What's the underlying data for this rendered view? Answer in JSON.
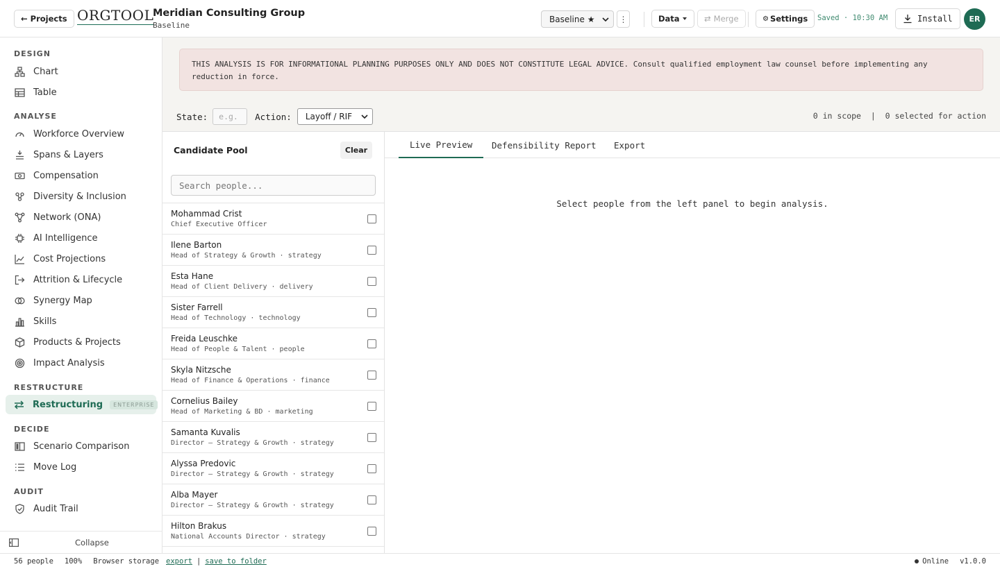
{
  "header": {
    "back_label": "← Projects",
    "logo": "ORGTOOL",
    "org_name": "Meridian Consulting Group",
    "scenario_name": "Baseline",
    "scenario_select": "Baseline ★",
    "data_label": "Data",
    "merge_label": "Merge",
    "settings_label": "Settings",
    "saved_status": "Saved · 10:30 AM",
    "install_label": "Install",
    "avatar_initials": "ER"
  },
  "sidebar": {
    "sections": [
      {
        "title": "DESIGN",
        "items": [
          {
            "label": "Chart",
            "icon": "org-chart-icon"
          },
          {
            "label": "Table",
            "icon": "table-icon"
          }
        ]
      },
      {
        "title": "ANALYSE",
        "items": [
          {
            "label": "Workforce Overview",
            "icon": "gauge-icon"
          },
          {
            "label": "Spans & Layers",
            "icon": "layers-icon"
          },
          {
            "label": "Compensation",
            "icon": "money-icon"
          },
          {
            "label": "Diversity & Inclusion",
            "icon": "people-icon"
          },
          {
            "label": "Network (ONA)",
            "icon": "network-icon"
          },
          {
            "label": "AI Intelligence",
            "icon": "chip-icon"
          },
          {
            "label": "Cost Projections",
            "icon": "line-chart-icon"
          },
          {
            "label": "Attrition & Lifecycle",
            "icon": "exit-icon"
          },
          {
            "label": "Synergy Map",
            "icon": "overlap-icon"
          },
          {
            "label": "Skills",
            "icon": "bar-chart-icon"
          },
          {
            "label": "Products & Projects",
            "icon": "box-icon"
          },
          {
            "label": "Impact Analysis",
            "icon": "target-icon"
          }
        ]
      },
      {
        "title": "RESTRUCTURE",
        "items": [
          {
            "label": "Restructuring",
            "icon": "swap-icon",
            "badge": "ENTERPRISE",
            "active": true
          }
        ]
      },
      {
        "title": "DECIDE",
        "items": [
          {
            "label": "Scenario Comparison",
            "icon": "columns-icon"
          },
          {
            "label": "Move Log",
            "icon": "list-icon"
          }
        ]
      },
      {
        "title": "AUDIT",
        "items": [
          {
            "label": "Audit Trail",
            "icon": "shield-check-icon"
          }
        ]
      }
    ],
    "collapse_label": "Collapse"
  },
  "disclaimer": "THIS ANALYSIS IS FOR INFORMATIONAL PLANNING PURPOSES ONLY AND DOES NOT CONSTITUTE LEGAL ADVICE. Consult qualified employment law counsel before implementing any reduction in force.",
  "filters": {
    "state_label": "State:",
    "state_placeholder": "e.g.",
    "action_label": "Action:",
    "action_value": "Layoff / RIF",
    "scope_text": "0 in scope  |  0 selected for action"
  },
  "candidate_pool": {
    "title": "Candidate Pool",
    "clear_label": "Clear",
    "search_placeholder": "Search people...",
    "people": [
      {
        "name": "Mohammad Crist",
        "role": "Chief Executive Officer"
      },
      {
        "name": "Ilene Barton",
        "role": "Head of Strategy & Growth · strategy"
      },
      {
        "name": "Esta Hane",
        "role": "Head of Client Delivery · delivery"
      },
      {
        "name": "Sister Farrell",
        "role": "Head of Technology · technology"
      },
      {
        "name": "Freida Leuschke",
        "role": "Head of People & Talent · people"
      },
      {
        "name": "Skyla Nitzsche",
        "role": "Head of Finance & Operations · finance"
      },
      {
        "name": "Cornelius Bailey",
        "role": "Head of Marketing & BD · marketing"
      },
      {
        "name": "Samanta Kuvalis",
        "role": "Director — Strategy & Growth · strategy"
      },
      {
        "name": "Alyssa Predovic",
        "role": "Director — Strategy & Growth · strategy"
      },
      {
        "name": "Alba Mayer",
        "role": "Director — Strategy & Growth · strategy"
      },
      {
        "name": "Hilton Brakus",
        "role": "National Accounts Director · strategy"
      }
    ]
  },
  "tabs": [
    "Live Preview",
    "Defensibility Report",
    "Export"
  ],
  "empty_message": "Select people from the left panel to begin analysis.",
  "statusbar": {
    "people_count": "56 people",
    "zoom": "100%",
    "storage": "Browser storage",
    "export_link": "export",
    "separator": "|",
    "save_link": "save to folder",
    "online": "Online",
    "version": "v1.0.0"
  }
}
